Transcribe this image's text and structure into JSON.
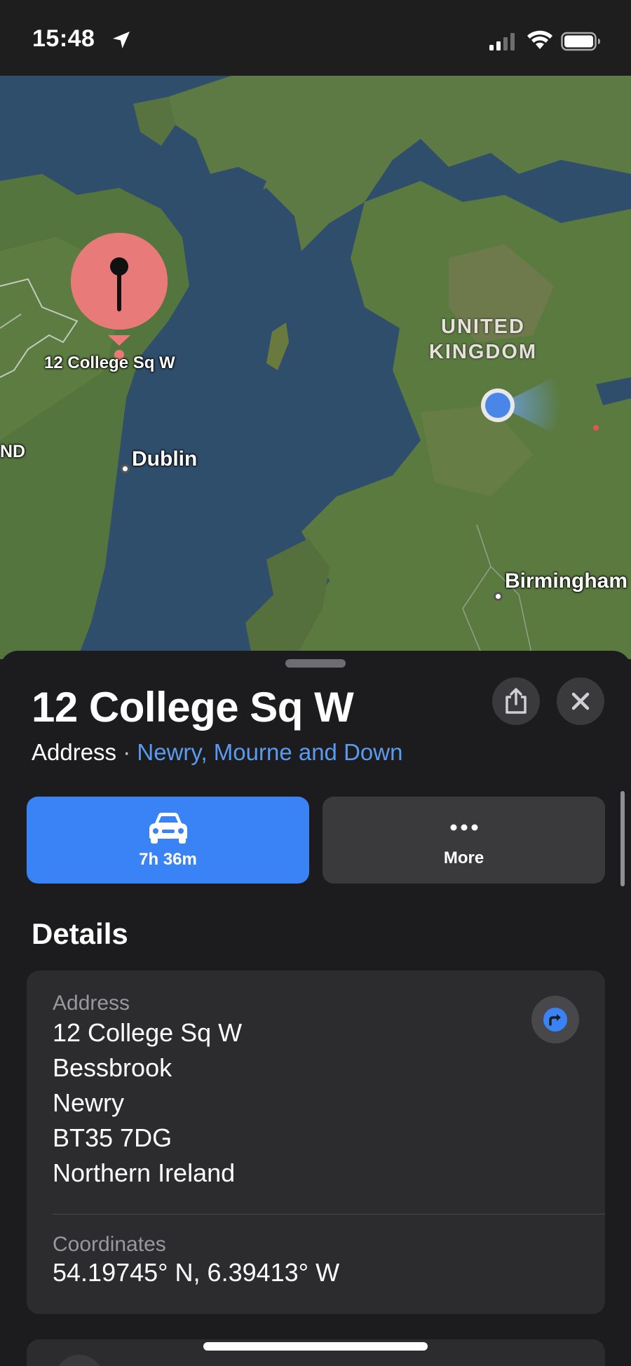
{
  "status_bar": {
    "time": "15:48"
  },
  "map": {
    "pin_label": "12 College Sq W",
    "country_label": "UNITED\nKINGDOM",
    "edge_label": "ND",
    "cities": {
      "dublin": "Dublin",
      "birmingham": "Birmingham"
    },
    "colors": {
      "pin": "#e57373",
      "user_location": "#4a86e8",
      "sea": "#2f4f6e",
      "land": "#55743c"
    }
  },
  "sheet": {
    "title": "12 College Sq W",
    "subtitle_type": "Address",
    "subtitle_separator": " · ",
    "subtitle_region": "Newry, Mourne and Down",
    "actions": {
      "drive_label": "7h 36m",
      "more_label": "More"
    },
    "details_title": "Details",
    "address": {
      "label": "Address",
      "lines": [
        "12 College Sq W",
        "Bessbrook",
        "Newry",
        "BT35 7DG",
        "Northern Ireland"
      ]
    },
    "coordinates": {
      "label": "Coordinates",
      "value": "54.19745° N, 6.39413° W"
    }
  }
}
